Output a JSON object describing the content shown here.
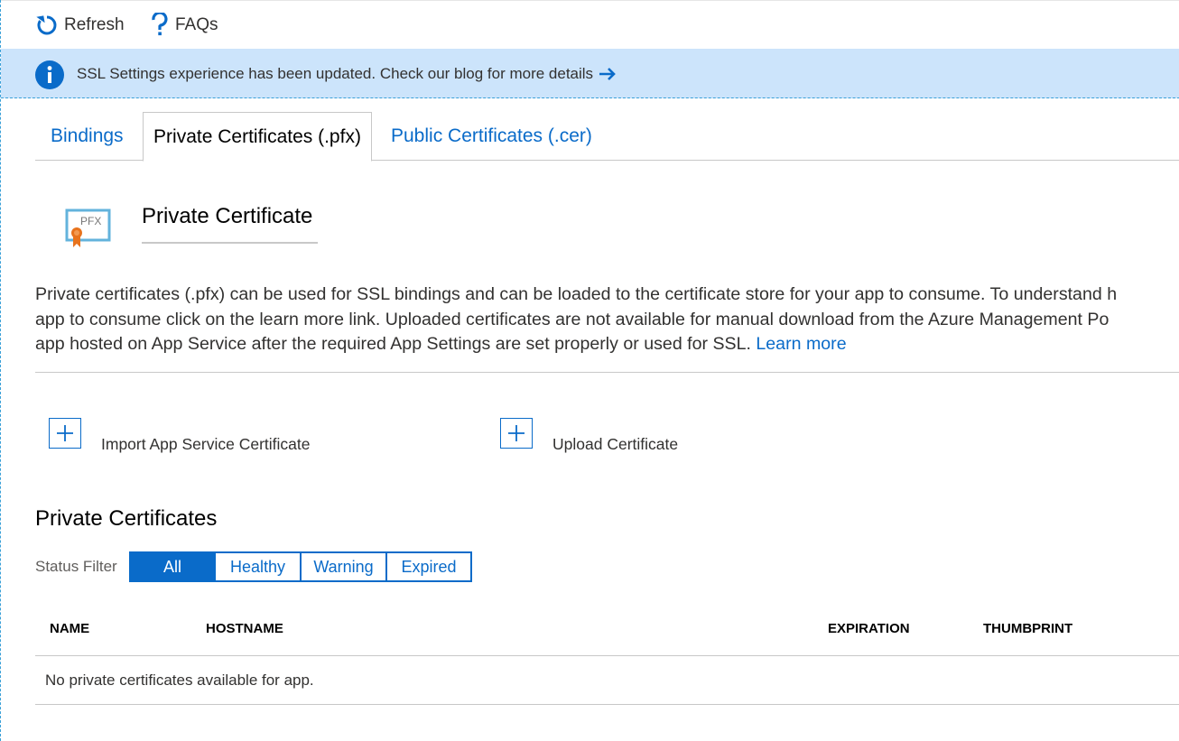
{
  "toolbar": {
    "refresh_label": "Refresh",
    "faq_label": "FAQs"
  },
  "banner": {
    "text": "SSL Settings experience has been updated. Check our blog for more details"
  },
  "tabs": [
    {
      "label": "Bindings"
    },
    {
      "label": "Private Certificates (.pfx)"
    },
    {
      "label": "Public Certificates (.cer)"
    }
  ],
  "certificate": {
    "icon_text": "PFX",
    "title": "Private Certificate",
    "description_lines": [
      "Private certificates (.pfx) can be used for SSL bindings and can be loaded to the certificate store for your app to consume. To understand h",
      "app to consume click on the learn more link. Uploaded certificates are not available for manual download from the Azure Management Po",
      "app hosted on App Service after the required App Settings are set properly or used for SSL. "
    ],
    "learn_more": "Learn more"
  },
  "actions": {
    "import_label": "Import App Service Certificate",
    "upload_label": "Upload Certificate"
  },
  "private_certificates": {
    "title": "Private Certificates",
    "filter_label": "Status Filter",
    "filters": [
      "All",
      "Healthy",
      "Warning",
      "Expired"
    ],
    "selected_filter": "All",
    "columns": [
      "NAME",
      "HOSTNAME",
      "EXPIRATION",
      "THUMBPRINT"
    ],
    "empty_message": "No private certificates available for app."
  },
  "colors": {
    "accent": "#0a6bc9",
    "banner_bg": "#cce4fb",
    "cert_badge": "#e8731d"
  }
}
